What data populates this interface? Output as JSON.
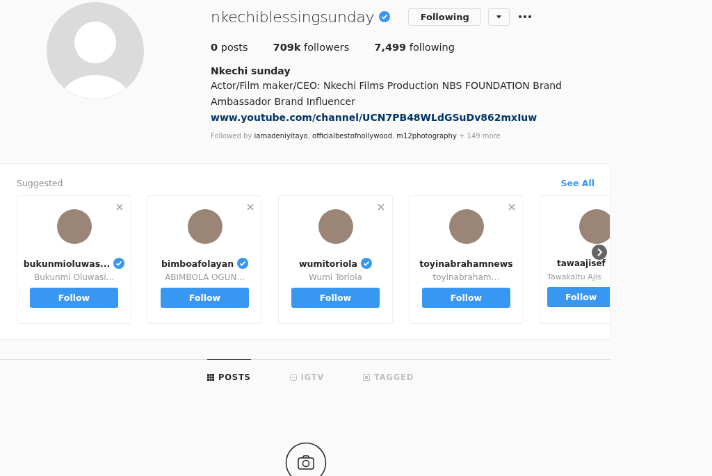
{
  "profile": {
    "username": "nkechiblessingsunday",
    "verified": true,
    "follow_button": "Following",
    "stats": [
      "**0** posts",
      "**709k** followers",
      "**7,499** following"
    ],
    "full_name": "Nkechi sunday",
    "bio": "Actor/Film maker/CEO: Nkechi Films Production NBS FOUNDATION Brand Ambassador Brand Influencer",
    "link": "www.youtube.com/channel/UCN7PB48WLdGSuDv862mxIuw",
    "followed_by": "Followed by **iamadeniyitayo**, **officialbestofnollywood**, **m12photography** + 149 more"
  },
  "suggested": {
    "title": "Suggested",
    "see_all": "See All",
    "cards": [
      {
        "kind": "full",
        "username": "bukunmioluwas...",
        "verified": true,
        "full_name": "Bukunmi Oluwasi...",
        "button": "Follow"
      },
      {
        "kind": "full",
        "username": "bimboafolayan",
        "verified": true,
        "full_name": "ABIMBOLA OGUN...",
        "button": "Follow"
      },
      {
        "kind": "full",
        "username": "wumitoriola",
        "verified": true,
        "full_name": "Wumi Toriola",
        "button": "Follow"
      },
      {
        "kind": "full",
        "username": "toyinabrahamnews",
        "verified": false,
        "full_name": "toyinabraham…",
        "button": "Follow"
      },
      {
        "kind": "partial",
        "username": "tawaajisef",
        "full_name": "Tawakaltu Ajis",
        "button": "Follow"
      }
    ]
  },
  "tabs": [
    {
      "label": "POSTS",
      "selected": true
    },
    {
      "label": "IGTV",
      "selected": false
    },
    {
      "label": "TAGGED",
      "selected": false
    }
  ]
}
